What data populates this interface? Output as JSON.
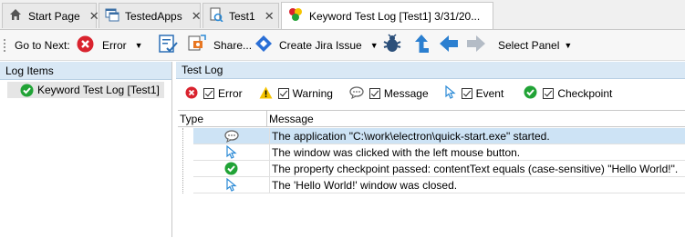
{
  "tabs": [
    {
      "label": "Start Page",
      "icon": "home-icon",
      "closable": true
    },
    {
      "label": "TestedApps",
      "icon": "tested-apps-icon",
      "closable": true
    },
    {
      "label": "Test1",
      "icon": "keyword-test-icon",
      "closable": true
    },
    {
      "label": "Keyword Test Log [Test1] 3/31/20...",
      "icon": "test-log-icon",
      "active": true
    }
  ],
  "toolbar": {
    "go_to_next": "Go to Next:",
    "error": "Error",
    "share": "Share...",
    "create_jira": "Create Jira Issue",
    "select_panel": "Select Panel"
  },
  "left_panel": {
    "header": "Log Items",
    "items": [
      {
        "label": "Keyword Test Log [Test1]",
        "icon": "passed-icon"
      }
    ]
  },
  "right_panel": {
    "header": "Test Log",
    "filters": [
      {
        "label": "Error",
        "icon": "error-icon",
        "color": "#d9232e"
      },
      {
        "label": "Warning",
        "icon": "warning-icon",
        "color": "#f5c400"
      },
      {
        "label": "Message",
        "icon": "message-icon",
        "color": "#777777"
      },
      {
        "label": "Event",
        "icon": "event-icon",
        "color": "#2b8ad6"
      },
      {
        "label": "Checkpoint",
        "icon": "checkpoint-icon",
        "color": "#21a336"
      }
    ],
    "columns": [
      "Type",
      "Message"
    ],
    "rows": [
      {
        "type": "message",
        "message": "The application \"C:\\work\\electron\\quick-start.exe\" started."
      },
      {
        "type": "event",
        "message": "The window was clicked with the left mouse button."
      },
      {
        "type": "checkpoint",
        "message": "The property checkpoint passed: contentText equals (case-sensitive) \"Hello World!\"."
      },
      {
        "type": "event",
        "message": "The 'Hello World!' window was closed."
      }
    ]
  },
  "colors": {
    "accent": "#2b8ad6",
    "error": "#d9232e",
    "success": "#21a336",
    "jira": "#2a6fd6"
  }
}
